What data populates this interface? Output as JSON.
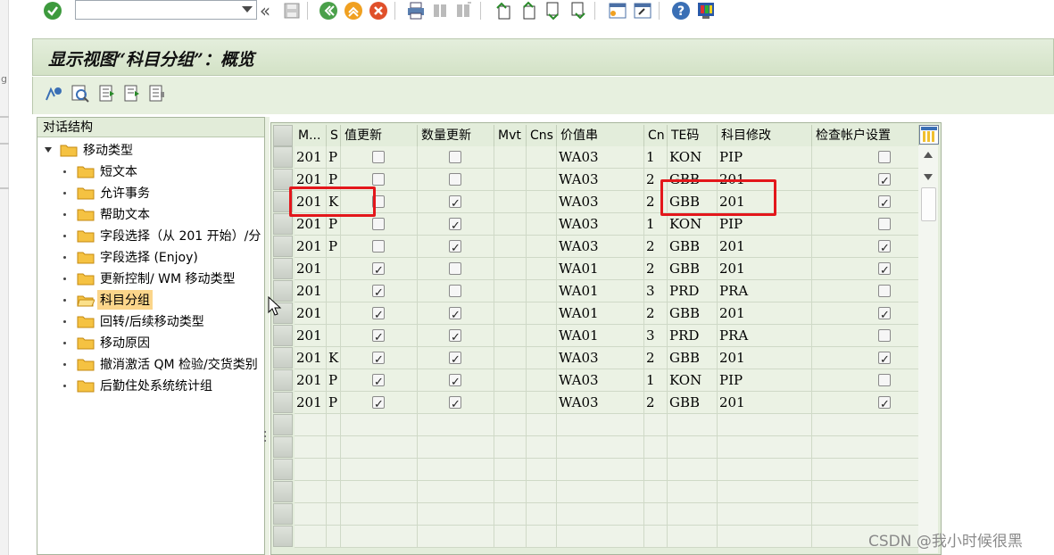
{
  "toolbar": {
    "command_field_value": "",
    "icons": [
      "enter-check-icon",
      "command-dropdown",
      "double-left-arrow-icon",
      "save-icon",
      "back-icon",
      "exit-icon",
      "cancel-icon",
      "print-icon",
      "find-icon",
      "find-next-icon",
      "first-page-icon",
      "previous-page-icon",
      "next-page-icon",
      "last-page-icon",
      "new-session-icon",
      "shortcut-icon",
      "help-icon",
      "layout-icon"
    ]
  },
  "title": "显示视图“科目分组”：概览",
  "app_toolbar": {
    "icons": [
      "change-display-icon",
      "details-icon",
      "select-all-icon",
      "deselect-icon",
      "select-block-icon"
    ]
  },
  "tree": {
    "header": "对话结构",
    "root": "移动类型",
    "children": [
      {
        "label": "短文本",
        "selected": false
      },
      {
        "label": "允许事务",
        "selected": false
      },
      {
        "label": "帮助文本",
        "selected": false
      },
      {
        "label": "字段选择（从 201 开始）/分",
        "selected": false
      },
      {
        "label": "字段选择 (Enjoy)",
        "selected": false
      },
      {
        "label": "更新控制/ WM 移动类型",
        "selected": false
      },
      {
        "label": "科目分组",
        "selected": true
      },
      {
        "label": "回转/后续移动类型",
        "selected": false
      },
      {
        "label": "移动原因",
        "selected": false
      },
      {
        "label": "撤消激活 QM 检验/交货类别",
        "selected": false
      },
      {
        "label": "后勤住处系统统计组",
        "selected": false
      }
    ]
  },
  "table": {
    "columns": [
      "M...",
      "S",
      "值更新",
      "数量更新",
      "Mvt",
      "Cns",
      "价值串",
      "Cn",
      "TE码",
      "科目修改",
      "检查帐户设置"
    ],
    "rows": [
      {
        "m": "201",
        "s": "P",
        "val": false,
        "qty": false,
        "mvt": "",
        "cns": "",
        "vs": "WA03",
        "cn": "1",
        "te": "KON",
        "acct": "PIP",
        "chk": false
      },
      {
        "m": "201",
        "s": "P",
        "val": false,
        "qty": false,
        "mvt": "",
        "cns": "",
        "vs": "WA03",
        "cn": "2",
        "te": "GBB",
        "acct": "201",
        "chk": true
      },
      {
        "m": "201",
        "s": "K",
        "val": false,
        "qty": true,
        "mvt": "",
        "cns": "",
        "vs": "WA03",
        "cn": "2",
        "te": "GBB",
        "acct": "201",
        "chk": true
      },
      {
        "m": "201",
        "s": "P",
        "val": false,
        "qty": true,
        "mvt": "",
        "cns": "",
        "vs": "WA03",
        "cn": "1",
        "te": "KON",
        "acct": "PIP",
        "chk": false
      },
      {
        "m": "201",
        "s": "P",
        "val": false,
        "qty": true,
        "mvt": "",
        "cns": "",
        "vs": "WA03",
        "cn": "2",
        "te": "GBB",
        "acct": "201",
        "chk": true
      },
      {
        "m": "201",
        "s": "",
        "val": true,
        "qty": false,
        "mvt": "",
        "cns": "",
        "vs": "WA01",
        "cn": "2",
        "te": "GBB",
        "acct": "201",
        "chk": true
      },
      {
        "m": "201",
        "s": "",
        "val": true,
        "qty": false,
        "mvt": "",
        "cns": "",
        "vs": "WA01",
        "cn": "3",
        "te": "PRD",
        "acct": "PRA",
        "chk": false
      },
      {
        "m": "201",
        "s": "",
        "val": true,
        "qty": true,
        "mvt": "",
        "cns": "",
        "vs": "WA01",
        "cn": "2",
        "te": "GBB",
        "acct": "201",
        "chk": true
      },
      {
        "m": "201",
        "s": "",
        "val": true,
        "qty": true,
        "mvt": "",
        "cns": "",
        "vs": "WA01",
        "cn": "3",
        "te": "PRD",
        "acct": "PRA",
        "chk": false
      },
      {
        "m": "201",
        "s": "K",
        "val": true,
        "qty": true,
        "mvt": "",
        "cns": "",
        "vs": "WA03",
        "cn": "2",
        "te": "GBB",
        "acct": "201",
        "chk": true
      },
      {
        "m": "201",
        "s": "P",
        "val": true,
        "qty": true,
        "mvt": "",
        "cns": "",
        "vs": "WA03",
        "cn": "1",
        "te": "KON",
        "acct": "PIP",
        "chk": false
      },
      {
        "m": "201",
        "s": "P",
        "val": true,
        "qty": true,
        "mvt": "",
        "cns": "",
        "vs": "WA03",
        "cn": "2",
        "te": "GBB",
        "acct": "201",
        "chk": true
      }
    ],
    "empty_rows": 6
  },
  "colors": {
    "title_bg": "#d3e2c6",
    "selected_node": "#fbd58a",
    "highlight_box": "#e3171b",
    "folder": "#f5c242"
  },
  "watermark": "CSDN @我小时候很黑"
}
